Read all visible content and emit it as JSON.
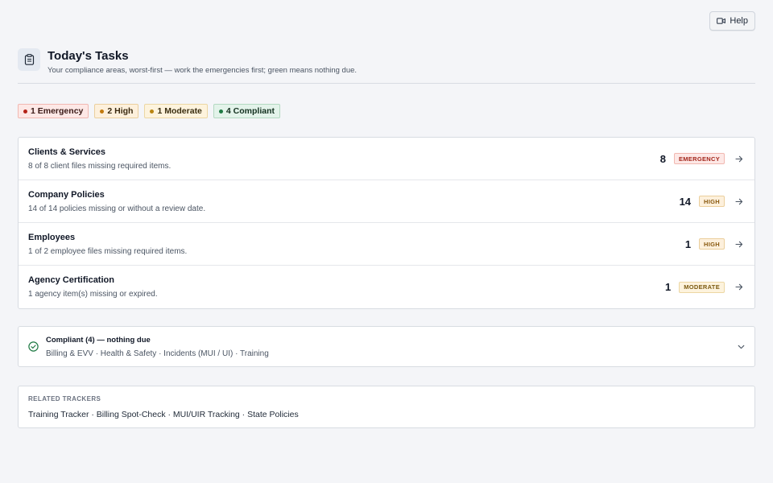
{
  "help": {
    "label": "Help",
    "icon": "video-icon"
  },
  "header": {
    "icon": "clipboard-icon",
    "title": "Today's Tasks",
    "subtitle": "Your compliance areas, worst-first — work the emergencies first; green means nothing due."
  },
  "summary": {
    "emergency": "1 Emergency",
    "high": "2 High",
    "moderate": "1 Moderate",
    "compliant": "4 Compliant"
  },
  "tasks": [
    {
      "title": "Clients & Services",
      "desc": "8 of 8 client files missing required items.",
      "count": "8",
      "badge": "EMERGENCY",
      "level": "emergency"
    },
    {
      "title": "Company Policies",
      "desc": "14 of 14 policies missing or without a review date.",
      "count": "14",
      "badge": "HIGH",
      "level": "high"
    },
    {
      "title": "Employees",
      "desc": "1 of 2 employee files missing required items.",
      "count": "1",
      "badge": "HIGH",
      "level": "high"
    },
    {
      "title": "Agency Certification",
      "desc": "1 agency item(s) missing or expired.",
      "count": "1",
      "badge": "MODERATE",
      "level": "moderate"
    }
  ],
  "compliant": {
    "title": "Compliant (4) — nothing due",
    "areas": "Billing & EVV · Health & Safety · Incidents (MUI / UI) · Training"
  },
  "related": {
    "label": "RELATED TRACKERS",
    "links": "Training Tracker · Billing Spot-Check · MUI/UIR Tracking · State Policies"
  },
  "colors": {
    "emergency": "#b42318",
    "high": "#c27a0e",
    "moderate": "#b98512",
    "compliant": "#1f7a44"
  }
}
